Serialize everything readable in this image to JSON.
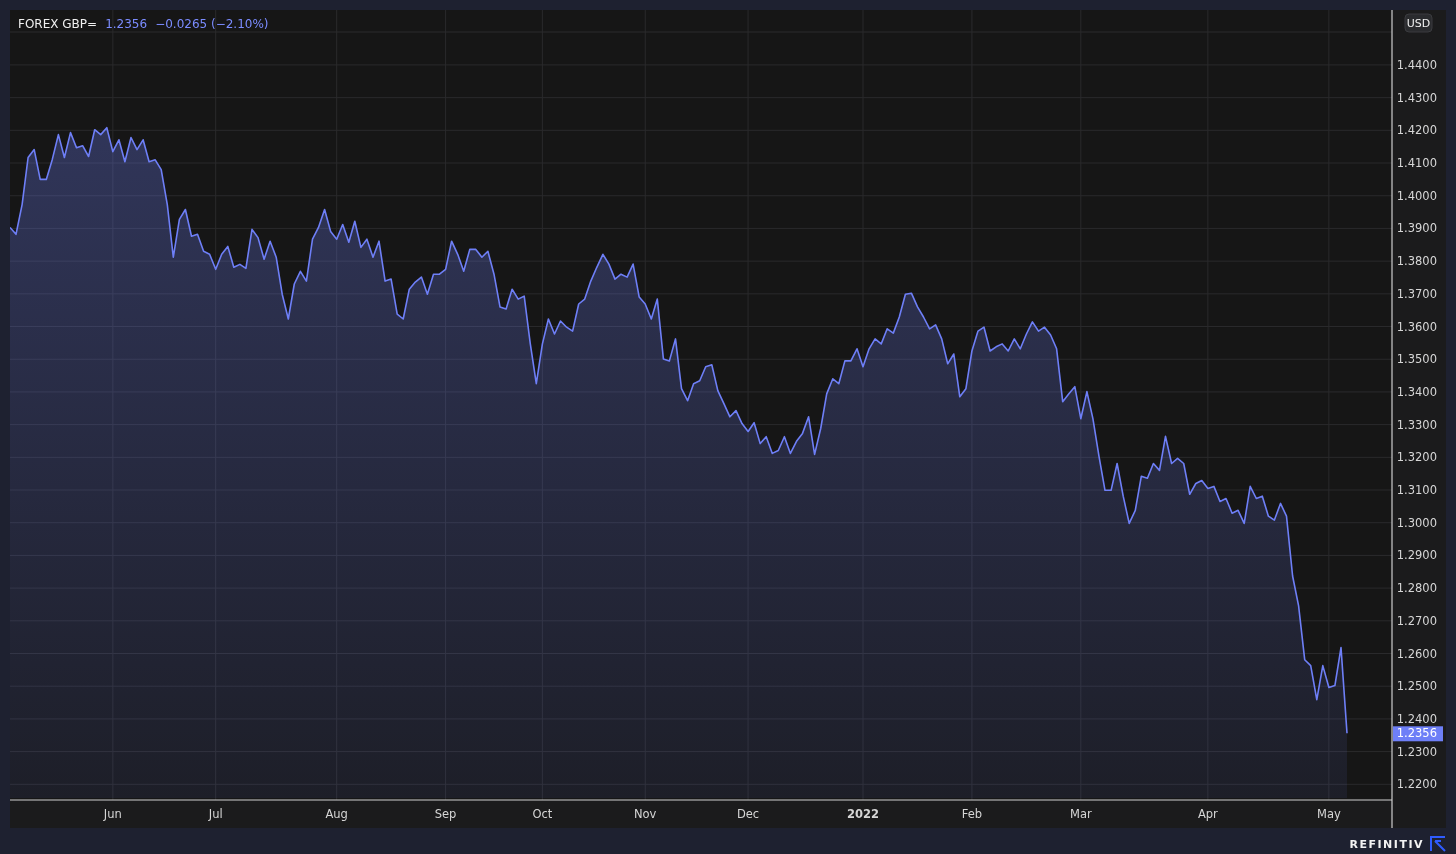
{
  "header": {
    "price": "1.2356",
    "change": "−0.0265 (−2.10%)"
  },
  "currency": "USD",
  "last_price_label": "1.2356",
  "brand": "REFINITIV",
  "chart_data": {
    "type": "area",
    "grid": true,
    "ylim": [
      1.2152,
      1.4568
    ],
    "categories": [
      null,
      null,
      null,
      null,
      null,
      null,
      null,
      null,
      null,
      null,
      null,
      null,
      null,
      null,
      null,
      null,
      null,
      "Jun",
      null,
      null,
      null,
      null,
      null,
      null,
      null,
      null,
      null,
      null,
      null,
      null,
      null,
      null,
      null,
      null,
      "Jul",
      null,
      null,
      null,
      null,
      null,
      null,
      null,
      null,
      null,
      null,
      null,
      null,
      null,
      null,
      null,
      null,
      null,
      null,
      null,
      "Aug",
      null,
      null,
      null,
      null,
      null,
      null,
      null,
      null,
      null,
      null,
      null,
      null,
      null,
      null,
      null,
      null,
      null,
      "Sep",
      null,
      null,
      null,
      null,
      null,
      null,
      null,
      null,
      null,
      null,
      null,
      null,
      null,
      null,
      null,
      "Oct",
      null,
      null,
      null,
      null,
      null,
      null,
      null,
      null,
      null,
      null,
      null,
      null,
      null,
      null,
      null,
      null,
      "Nov",
      null,
      null,
      null,
      null,
      null,
      null,
      null,
      null,
      null,
      null,
      null,
      null,
      null,
      null,
      null,
      null,
      "Dec",
      null,
      null,
      null,
      null,
      null,
      null,
      null,
      null,
      null,
      null,
      null,
      null,
      null,
      null,
      null,
      null,
      null,
      null,
      "2022",
      null,
      null,
      null,
      null,
      null,
      null,
      null,
      null,
      null,
      null,
      null,
      null,
      null,
      null,
      null,
      null,
      null,
      "Feb",
      null,
      null,
      null,
      null,
      null,
      null,
      null,
      null,
      null,
      null,
      null,
      null,
      null,
      null,
      null,
      null,
      null,
      "Mar",
      null,
      null,
      null,
      null,
      null,
      null,
      null,
      null,
      null,
      null,
      null,
      null,
      null,
      null,
      null,
      null,
      null,
      null,
      null,
      null,
      "Apr",
      null,
      null,
      null,
      null,
      null,
      null,
      null,
      null,
      null,
      null,
      null,
      null,
      null,
      null,
      null,
      null,
      null,
      null,
      null,
      "May",
      null,
      null,
      null
    ],
    "yticks": [
      {
        "value": 1.22,
        "label": "1.2200"
      },
      {
        "value": 1.23,
        "label": "1.2300"
      },
      {
        "value": 1.24,
        "label": "1.2400"
      },
      {
        "value": 1.25,
        "label": "1.2500"
      },
      {
        "value": 1.26,
        "label": "1.2600"
      },
      {
        "value": 1.27,
        "label": "1.2700"
      },
      {
        "value": 1.28,
        "label": "1.2800"
      },
      {
        "value": 1.29,
        "label": "1.2900"
      },
      {
        "value": 1.3,
        "label": "1.3000"
      },
      {
        "value": 1.31,
        "label": "1.3100"
      },
      {
        "value": 1.32,
        "label": "1.3200"
      },
      {
        "value": 1.33,
        "label": "1.3300"
      },
      {
        "value": 1.34,
        "label": "1.3400"
      },
      {
        "value": 1.35,
        "label": "1.3500"
      },
      {
        "value": 1.36,
        "label": "1.3600"
      },
      {
        "value": 1.37,
        "label": "1.3700"
      },
      {
        "value": 1.38,
        "label": "1.3800"
      },
      {
        "value": 1.39,
        "label": "1.3900"
      },
      {
        "value": 1.4,
        "label": "1.4000"
      },
      {
        "value": 1.41,
        "label": "1.4100"
      },
      {
        "value": 1.42,
        "label": "1.4200"
      },
      {
        "value": 1.43,
        "label": "1.4300"
      },
      {
        "value": 1.44,
        "label": "1.4400"
      }
    ],
    "series": [
      {
        "name": "FOREX GBP=",
        "color": "#6e7ff7",
        "values": [
          1.3903,
          1.3882,
          1.3973,
          1.4117,
          1.4141,
          1.405,
          1.405,
          1.4111,
          1.4187,
          1.4117,
          1.4193,
          1.4147,
          1.4153,
          1.412,
          1.4202,
          1.4187,
          1.4208,
          1.4135,
          1.4171,
          1.4104,
          1.4178,
          1.4141,
          1.4171,
          1.4104,
          1.411,
          1.408,
          1.3973,
          1.3812,
          1.3928,
          1.3958,
          1.3876,
          1.3882,
          1.383,
          1.3821,
          1.3775,
          1.3821,
          1.3845,
          1.3781,
          1.379,
          1.3778,
          1.3897,
          1.3872,
          1.3806,
          1.3861,
          1.3812,
          1.3699,
          1.3623,
          1.373,
          1.3769,
          1.3739,
          1.3867,
          1.3903,
          1.3958,
          1.3891,
          1.3867,
          1.3912,
          1.3858,
          1.3922,
          1.3842,
          1.3867,
          1.3812,
          1.3861,
          1.3739,
          1.3745,
          1.3638,
          1.3623,
          1.3714,
          1.3736,
          1.3751,
          1.3699,
          1.376,
          1.376,
          1.3775,
          1.3861,
          1.3821,
          1.3769,
          1.3836,
          1.3836,
          1.3812,
          1.383,
          1.376,
          1.366,
          1.3654,
          1.3714,
          1.3684,
          1.3693,
          1.3547,
          1.3425,
          1.3547,
          1.3623,
          1.3577,
          1.3617,
          1.3598,
          1.3586,
          1.3669,
          1.3684,
          1.3739,
          1.3781,
          1.3821,
          1.3791,
          1.3745,
          1.376,
          1.3751,
          1.3791,
          1.369,
          1.3669,
          1.3623,
          1.3684,
          1.3501,
          1.3495,
          1.3562,
          1.341,
          1.3373,
          1.3425,
          1.3434,
          1.3477,
          1.3483,
          1.3404,
          1.3364,
          1.3324,
          1.3343,
          1.3303,
          1.3279,
          1.3306,
          1.3242,
          1.3263,
          1.3212,
          1.3221,
          1.3263,
          1.3212,
          1.3249,
          1.3273,
          1.3324,
          1.3209,
          1.3288,
          1.3394,
          1.344,
          1.3425,
          1.3495,
          1.3495,
          1.3532,
          1.3477,
          1.3532,
          1.3562,
          1.3547,
          1.3593,
          1.358,
          1.3629,
          1.3699,
          1.3702,
          1.366,
          1.3629,
          1.3593,
          1.3605,
          1.3562,
          1.3486,
          1.3516,
          1.3385,
          1.341,
          1.3525,
          1.3586,
          1.3598,
          1.3525,
          1.3538,
          1.3547,
          1.3525,
          1.3562,
          1.3532,
          1.3577,
          1.3614,
          1.3586,
          1.3598,
          1.3574,
          1.3532,
          1.337,
          1.3394,
          1.3416,
          1.3318,
          1.3401,
          1.3318,
          1.3203,
          1.3099,
          1.3099,
          1.3181,
          1.3081,
          1.2998,
          1.3038,
          1.3142,
          1.3136,
          1.3181,
          1.316,
          1.3264,
          1.3181,
          1.3197,
          1.3181,
          1.3087,
          1.312,
          1.3129,
          1.3105,
          1.3111,
          1.3065,
          1.3074,
          1.3029,
          1.3038,
          1.2998,
          1.3111,
          1.3074,
          1.3081,
          1.302,
          1.3008,
          1.3059,
          1.302,
          1.2837,
          1.2746,
          1.2581,
          1.2563,
          1.2459,
          1.2563,
          1.2496,
          1.2502,
          1.2618,
          1.2356
        ]
      }
    ]
  }
}
